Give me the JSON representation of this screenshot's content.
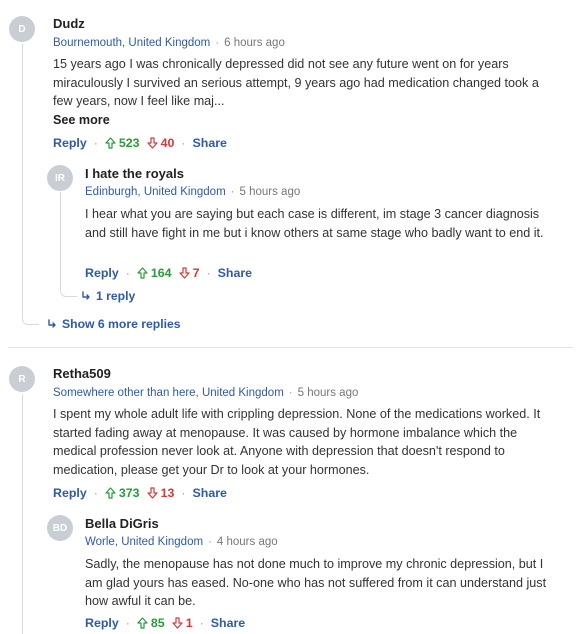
{
  "comments": [
    {
      "avatar": "D",
      "author": "Dudz",
      "location": "Bournemouth, United Kingdom",
      "time": "6 hours ago",
      "body": "15 years ago I was chronically depressed did not see any future went on for years miraculously I survived an serious attempt,  9 years ago had medication changed took a few years, now I feel like maj...",
      "see_more": "See more",
      "reply_label": "Reply",
      "upvotes": "523",
      "downvotes": "40",
      "share_label": "Share",
      "replies": [
        {
          "avatar": "IR",
          "author": "I hate the royals",
          "location": "Edinburgh, United Kingdom",
          "time": "5 hours ago",
          "body": "I hear what you are saying but each case is different, im stage 3 cancer diagnosis and still have fight in me but i know others at same stage who badly want to end it.",
          "reply_label": "Reply",
          "upvotes": "164",
          "downvotes": "7",
          "share_label": "Share",
          "reply_count_label": "1 reply"
        }
      ],
      "more_replies_label": "Show 6 more replies"
    },
    {
      "avatar": "R",
      "author": "Retha509",
      "location": "Somewhere other than here, United Kingdom",
      "time": "5 hours ago",
      "body": "I spent my whole adult life with crippling depression. None of the medications worked. It started fading away at menopause. It was caused by hormone imbalance which the medical profession never look at. Anyone with depression that doesn't respond to medication, please get your Dr to look at your hormones.",
      "reply_label": "Reply",
      "upvotes": "373",
      "downvotes": "13",
      "share_label": "Share",
      "replies": [
        {
          "avatar": "BD",
          "author": "Bella DiGris",
          "location": "Worle, United Kingdom",
          "time": "4 hours ago",
          "body": "Sadly, the menopause has not done much to improve my chronic depression, but I am glad yours has eased. No-one who has not suffered from it can understand just how awful it can be.",
          "reply_label": "Reply",
          "upvotes": "85",
          "downvotes": "1",
          "share_label": "Share"
        }
      ]
    }
  ],
  "colors": {
    "link": "#2f5aa8",
    "upvote": "#2a9a3a",
    "downvote": "#d13a3a",
    "avatar_bg": "#c9ced4"
  }
}
